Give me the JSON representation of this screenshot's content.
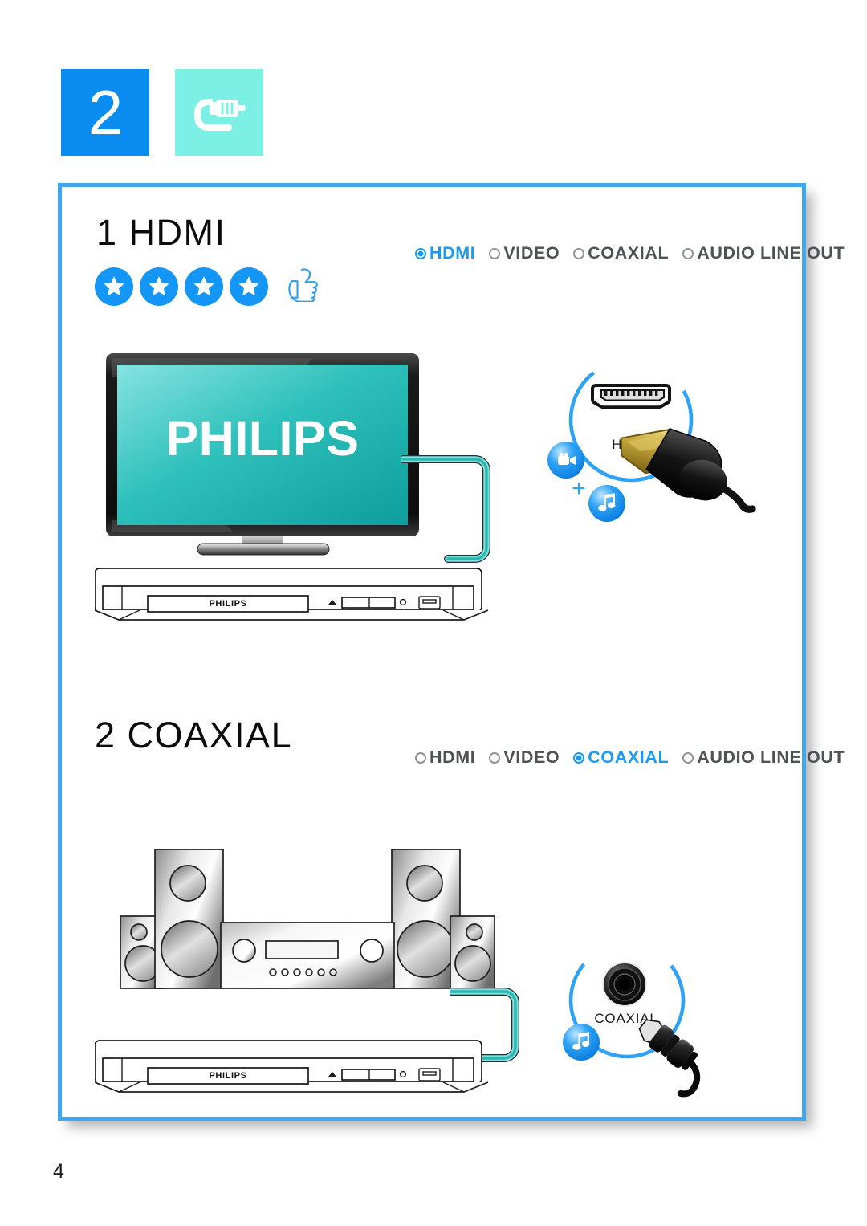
{
  "page": {
    "number": "4",
    "step_badge": "2",
    "step_icon": "cable-plug-icon",
    "accent_blue": "#0a8cf0",
    "accent_cyan": "#7df0e6",
    "frame_border": "#41a5f0",
    "cable_color": "#4cc8c8"
  },
  "sections": [
    {
      "id": "hdmi",
      "title": "1 HDMI",
      "rating": {
        "stars": 4,
        "thumb": "thumbs-up-icon"
      },
      "legend": [
        {
          "label": "HDMI",
          "selected": true
        },
        {
          "label": "VIDEO",
          "selected": false
        },
        {
          "label": "COAXIAL",
          "selected": false
        },
        {
          "label": "AUDIO LINE OUT",
          "selected": false
        }
      ],
      "display": {
        "brand": "PHILIPS",
        "screen_color": "#17b2ac"
      },
      "player": {
        "brand": "PHILIPS"
      },
      "port": {
        "name": "HDMI",
        "icon": "hdmi-port-icon",
        "connector": "hdmi-connector-icon",
        "signals": [
          "video-camera-icon",
          "music-note-icon"
        ],
        "plus": "+"
      }
    },
    {
      "id": "coaxial",
      "title": "2 COAXIAL",
      "legend": [
        {
          "label": "HDMI",
          "selected": false
        },
        {
          "label": "VIDEO",
          "selected": false
        },
        {
          "label": "COAXIAL",
          "selected": true
        },
        {
          "label": "AUDIO LINE OUT",
          "selected": false
        }
      ],
      "player": {
        "brand": "PHILIPS"
      },
      "port": {
        "name": "COAXIAL",
        "icon": "coaxial-port-icon",
        "connector": "coaxial-connector-icon",
        "signals": [
          "music-note-icon"
        ]
      }
    }
  ]
}
